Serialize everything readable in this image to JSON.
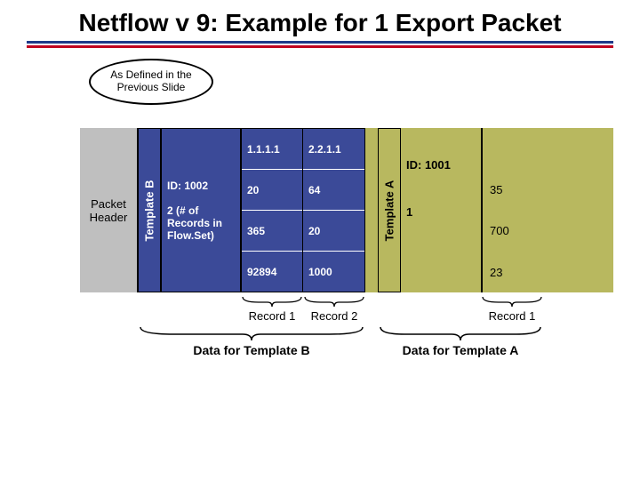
{
  "title": "Netflow v 9: Example for 1 Export Packet",
  "callout": "As Defined in the Previous Slide",
  "packet_header_label": "Packet Header",
  "templateB": {
    "vlabel": "Template B",
    "id_label": "ID: 1002",
    "count_label": "2 (# of Records in Flow.Set)",
    "records": [
      {
        "c1": "1.1.1.1",
        "c2": "20",
        "c3": "365",
        "c4": "92894"
      },
      {
        "c1": "2.2.1.1",
        "c2": "64",
        "c3": "20",
        "c4": "1000"
      }
    ],
    "rec_labels": [
      "Record 1",
      "Record 2"
    ],
    "footer": "Data for Template B"
  },
  "templateA": {
    "vlabel": "Template A",
    "id_label": "ID: 1001",
    "count_label": "1",
    "records": [
      {
        "c1": "35",
        "c2": "700",
        "c3": "23"
      }
    ],
    "rec_labels": [
      "Record 1"
    ],
    "footer": "Data for Template A"
  }
}
